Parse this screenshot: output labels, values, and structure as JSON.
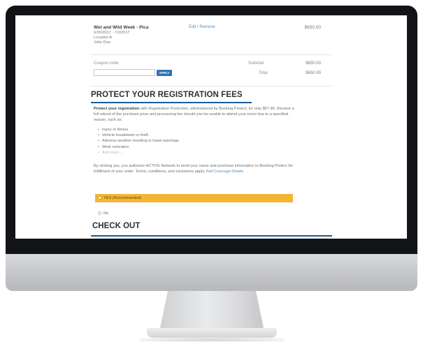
{
  "cart": {
    "event_name": "Wet and Wild Week - Pica",
    "dates": "6/26/2017 - 7/2/2017",
    "location": "Location A",
    "participant": "John Doe",
    "edit_remove": "Edit / Remove",
    "price": "$650.00"
  },
  "coupon": {
    "label": "Coupon code",
    "input_value": "",
    "apply_label": "APPLY"
  },
  "totals": {
    "subtotal_label": "Subtotal",
    "subtotal_value": "$650.00",
    "total_label": "Total",
    "total_value": "$650.00"
  },
  "protect": {
    "title": "PROTECT YOUR REGISTRATION FEES",
    "intro_bold": "Protect your registration",
    "intro_rest": " with Registration Protection, administered by Booking Protect, for only $57.99. Receive a full refund of the purchase price and processing fee should you be unable to attend your event due to a specified reason, such as:",
    "reasons": [
      "Injury or illness",
      "Vehicle breakdown or theft",
      "Adverse weather resulting in travel warnings",
      "Work relocation",
      "And more..."
    ],
    "consent_text": "By clicking yes, you authorize ACTIVE Network to send your name and purchase information to Booking Protect for fulfillment of your order. Terms, conditions, and exclusions apply. Full ",
    "coverage_link": "Coverage Details",
    "yes_option": "YES (Recommended)",
    "no_option": "No"
  },
  "checkout": {
    "title": "CHECK OUT"
  },
  "colors": {
    "accent_blue": "#1a5c96",
    "button_blue": "#2f74b8",
    "recommended_yellow": "#f5b433"
  }
}
